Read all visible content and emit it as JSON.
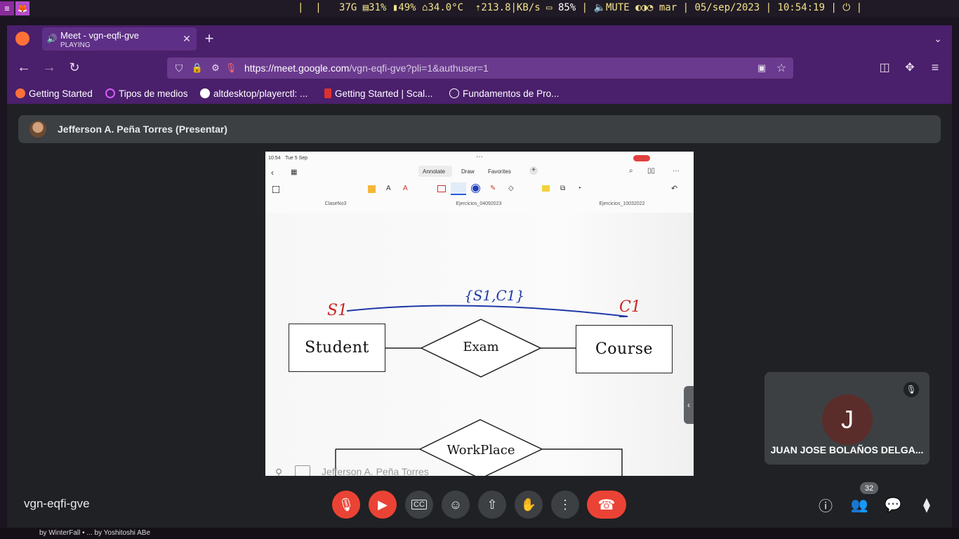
{
  "system_bar": {
    "storage": "37G",
    "cpu": "31%",
    "memory": "49%",
    "temperature": "34.0°C",
    "net_speed": "213.8|KB/s",
    "battery": "85%",
    "volume": "MUTE",
    "day": "mar",
    "date": "05/sep/2023",
    "time": "10:54:19"
  },
  "browser": {
    "tab_title": "Meet - vgn-eqfi-gve",
    "tab_status": "PLAYING",
    "url_host": "https://meet.google.com",
    "url_path": "/vgn-eqfi-gve?pli=1&authuser=1",
    "bookmarks": [
      {
        "label": "Getting Started",
        "icon": "firefox-icon"
      },
      {
        "label": "Tipos de medios",
        "icon": "circle-icon"
      },
      {
        "label": "altdesktop/playerctl: ...",
        "icon": "github-icon"
      },
      {
        "label": "Getting Started | Scal...",
        "icon": "scala-icon"
      },
      {
        "label": "Fundamentos de Pro...",
        "icon": "globe-icon"
      }
    ]
  },
  "meet": {
    "presenter_name": "Jefferson A. Peña Torres (Presentar)",
    "shared_screen": {
      "status_time": "10:54",
      "status_date": "Tue 5 Sep",
      "toolbar_tabs": [
        "Annotate",
        "Draw",
        "Favorites"
      ],
      "doc_tabs": [
        "ClaseNo3",
        "Ejercicios_04092023",
        "Ejercicios_10032022"
      ],
      "diagram": {
        "entities": [
          "Student",
          "Course"
        ],
        "relationships": [
          "Exam",
          "WorkPlace"
        ],
        "handwriting": {
          "left": "S1",
          "right": "C1",
          "edge": "{S1,C1}"
        }
      },
      "overlay_name": "Jefferson A. Peña Torres"
    },
    "participant_tile": {
      "initial": "J",
      "name": "JUAN JOSE BOLAÑOS DELGA..."
    },
    "meeting_code": "vgn-eqfi-gve",
    "participants_count": "32"
  },
  "wallpaper_caption": "by WinterFall  •  ...  by Yoshitoshi ABe"
}
